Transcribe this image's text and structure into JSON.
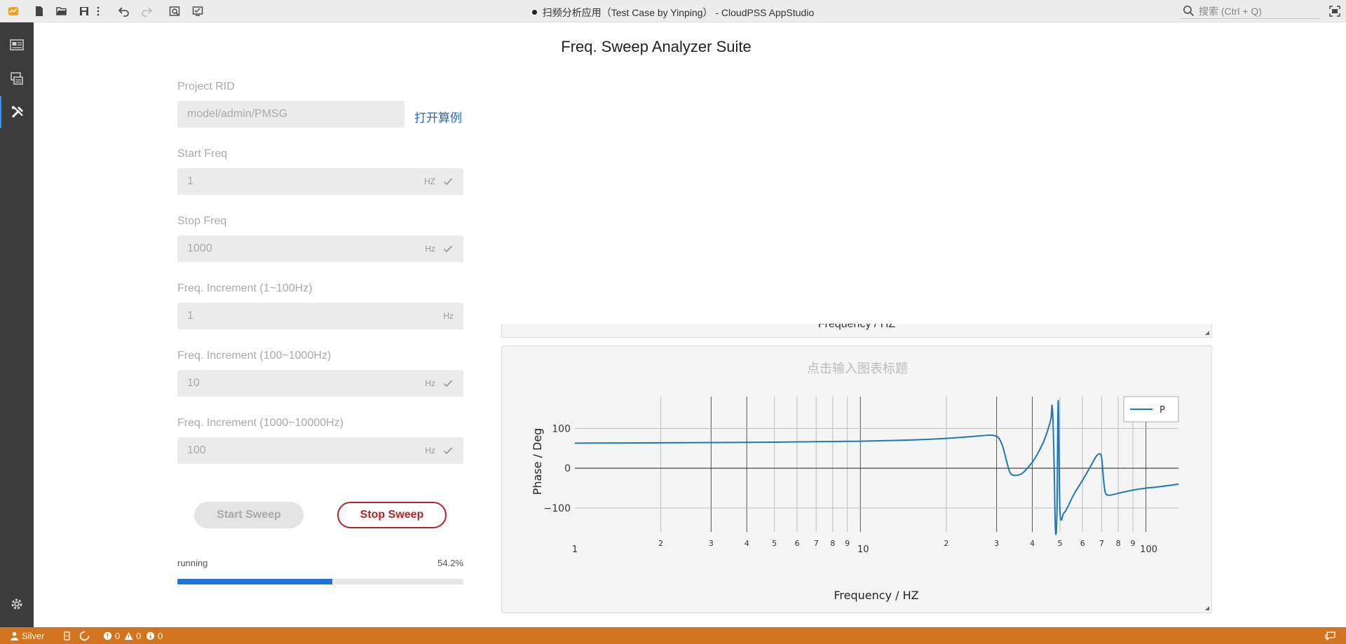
{
  "titlebar": {
    "title": "扫频分析应用（Test Case by Yinping） - CloudPSS AppStudio",
    "search_placeholder": "搜索 (Ctrl + Q)",
    "toolbar_icons": [
      "new-file-icon",
      "open-folder-icon",
      "save-icon",
      "more-icon",
      "undo-icon",
      "redo-icon",
      "preview-icon",
      "run-icon"
    ]
  },
  "sidebar": {
    "items": [
      "layout-icon",
      "components-icon",
      "tools-icon"
    ],
    "settings": "gear-icon"
  },
  "page": {
    "title": "Freq. Sweep Analyzer Suite"
  },
  "form": {
    "project_rid_label": "Project RID",
    "project_rid_value": "model/admin/PMSG",
    "open_case_link": "打开算例",
    "start_freq_label": "Start Freq",
    "start_freq_value": "1",
    "start_freq_unit": "HZ",
    "stop_freq_label": "Stop Freq",
    "stop_freq_value": "1000",
    "stop_freq_unit": "Hz",
    "inc1_label": "Freq. Increment (1~100Hz)",
    "inc1_value": "1",
    "inc1_unit": "Hz",
    "inc2_label": "Freq. Increment (100~1000Hz)",
    "inc2_value": "10",
    "inc2_unit": "Hz",
    "inc3_label": "Freq. Increment (1000~10000Hz)",
    "inc3_value": "100",
    "inc3_unit": "Hz"
  },
  "buttons": {
    "start_label": "Start Sweep",
    "stop_label": "Stop Sweep"
  },
  "progress": {
    "status": "running",
    "percent_text": "54.2%",
    "fraction": 0.542
  },
  "top_chart": {
    "xlabel": "Frequency / HZ"
  },
  "chart_data": {
    "type": "line",
    "title": "点击输入图表标题",
    "xlabel": "Frequency / HZ",
    "ylabel": "Phase / Deg",
    "xscale": "log",
    "xlim": [
      1,
      130
    ],
    "ylim": [
      -160,
      180
    ],
    "y_ticks": [
      100,
      0,
      -100
    ],
    "y_tick_labels": [
      "100",
      "0",
      "−100"
    ],
    "x_tick_labels": [
      {
        "x": 1,
        "label": "1"
      },
      {
        "x": 2,
        "label": "2"
      },
      {
        "x": 3,
        "label": "3"
      },
      {
        "x": 4,
        "label": "4"
      },
      {
        "x": 5,
        "label": "5"
      },
      {
        "x": 6,
        "label": "6"
      },
      {
        "x": 7,
        "label": "7"
      },
      {
        "x": 8,
        "label": "8"
      },
      {
        "x": 9,
        "label": "9"
      },
      {
        "x": 10,
        "label": "10"
      },
      {
        "x": 20,
        "label": "2"
      },
      {
        "x": 30,
        "label": "3"
      },
      {
        "x": 40,
        "label": "4"
      },
      {
        "x": 50,
        "label": "5"
      },
      {
        "x": 60,
        "label": "6"
      },
      {
        "x": 70,
        "label": "7"
      },
      {
        "x": 80,
        "label": "8"
      },
      {
        "x": 90,
        "label": "9"
      },
      {
        "x": 100,
        "label": "100"
      }
    ],
    "grid": true,
    "legend": "top-right",
    "color": "#1f77b4",
    "series": [
      {
        "name": "P",
        "x": [
          1,
          2,
          5,
          10,
          15,
          20,
          25,
          28,
          29.5,
          30.5,
          31.5,
          32.5,
          33.5,
          35,
          37,
          40,
          42,
          44,
          45.5,
          46.5,
          47,
          47.6,
          48.2,
          48.8,
          49.3,
          50,
          51.5,
          53,
          56,
          60,
          64,
          67,
          69,
          70,
          71,
          72,
          74,
          80,
          90,
          100,
          110,
          130
        ],
        "y": [
          63,
          64,
          65.5,
          68,
          71,
          75,
          80,
          83,
          82,
          76,
          55,
          18,
          -12,
          -18,
          -12,
          15,
          40,
          70,
          100,
          125,
          155,
          40,
          -155,
          -110,
          170,
          -108,
          -113,
          -100,
          -65,
          -30,
          5,
          30,
          36,
          25,
          -25,
          -60,
          -68,
          -63,
          -55,
          -50,
          -47,
          -40
        ]
      }
    ]
  }
}
